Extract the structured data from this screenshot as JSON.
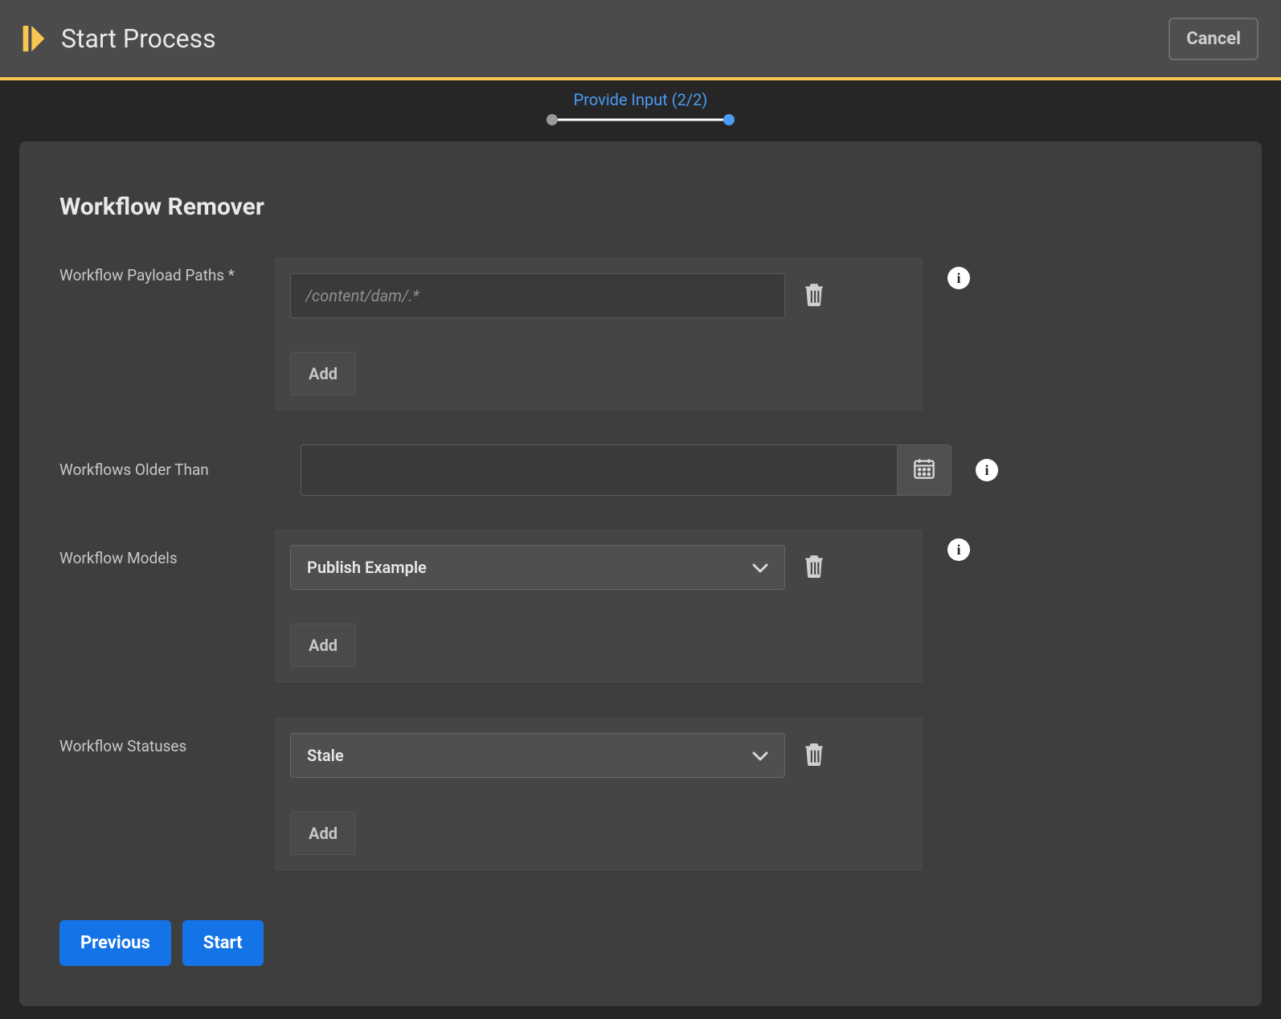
{
  "header": {
    "title": "Start Process",
    "cancel": "Cancel"
  },
  "stepper": {
    "label": "Provide Input (2/2)"
  },
  "form": {
    "title": "Workflow Remover",
    "payload": {
      "label": "Workflow Payload Paths *",
      "placeholder": "/content/dam/.*",
      "value": "",
      "add": "Add"
    },
    "older": {
      "label": "Workflows Older Than",
      "value": ""
    },
    "models": {
      "label": "Workflow Models",
      "selected": "Publish Example",
      "add": "Add"
    },
    "statuses": {
      "label": "Workflow Statuses",
      "selected": "Stale",
      "add": "Add"
    }
  },
  "footer": {
    "prev": "Previous",
    "start": "Start"
  }
}
